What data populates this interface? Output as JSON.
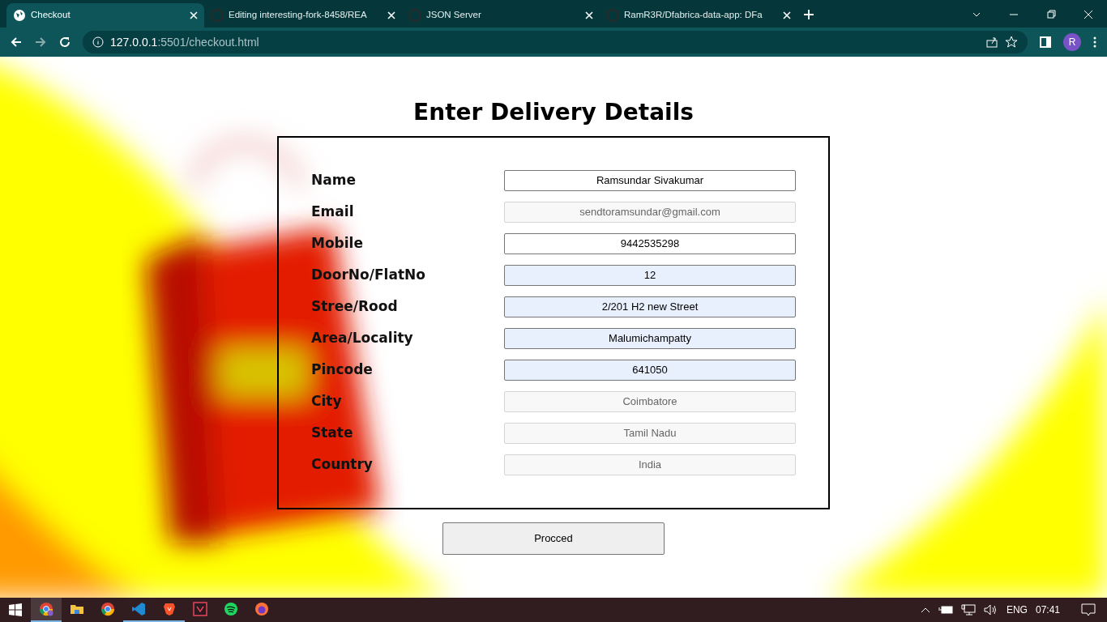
{
  "browser": {
    "tabs": [
      {
        "title": "Checkout",
        "selected": true
      },
      {
        "title": "Editing interesting-fork-8458/REA",
        "selected": false
      },
      {
        "title": "JSON Server",
        "selected": false
      },
      {
        "title": "RamR3R/Dfabrica-data-app: DFa",
        "selected": false
      }
    ],
    "address": {
      "host": "127.0.0.1",
      "path": ":5501/checkout.html"
    },
    "profile_initial": "R"
  },
  "page": {
    "heading": "Enter Delivery Details",
    "fields": [
      {
        "label": "Name",
        "value": "Ramsundar Sivakumar",
        "disabled": false,
        "autofilled": false
      },
      {
        "label": "Email",
        "value": "sendtoramsundar@gmail.com",
        "disabled": true,
        "autofilled": false
      },
      {
        "label": "Mobile",
        "value": "9442535298",
        "disabled": false,
        "autofilled": false
      },
      {
        "label": "DoorNo/FlatNo",
        "value": "12",
        "disabled": false,
        "autofilled": true
      },
      {
        "label": "Stree/Rood",
        "value": "2/201 H2 new Street",
        "disabled": false,
        "autofilled": true
      },
      {
        "label": "Area/Locality",
        "value": "Malumichampatty",
        "disabled": false,
        "autofilled": true
      },
      {
        "label": "Pincode",
        "value": "641050",
        "disabled": false,
        "autofilled": true
      },
      {
        "label": "City",
        "value": "Coimbatore",
        "disabled": true,
        "autofilled": false
      },
      {
        "label": "State",
        "value": "Tamil Nadu",
        "disabled": true,
        "autofilled": false
      },
      {
        "label": "Country",
        "value": "India",
        "disabled": true,
        "autofilled": false
      }
    ],
    "button": "Procced"
  },
  "taskbar": {
    "apps": [
      {
        "kind": "chrome-profile",
        "running": true,
        "selected": true
      },
      {
        "kind": "folder",
        "running": false,
        "selected": false
      },
      {
        "kind": "chrome",
        "running": false,
        "selected": false
      },
      {
        "kind": "vscode",
        "running": true,
        "selected": false
      },
      {
        "kind": "brave",
        "running": true,
        "selected": false
      },
      {
        "kind": "valorant",
        "running": false,
        "selected": false
      },
      {
        "kind": "spotify",
        "running": false,
        "selected": false
      },
      {
        "kind": "firefox",
        "running": false,
        "selected": false
      }
    ],
    "language": "ENG",
    "time": "07:41"
  }
}
